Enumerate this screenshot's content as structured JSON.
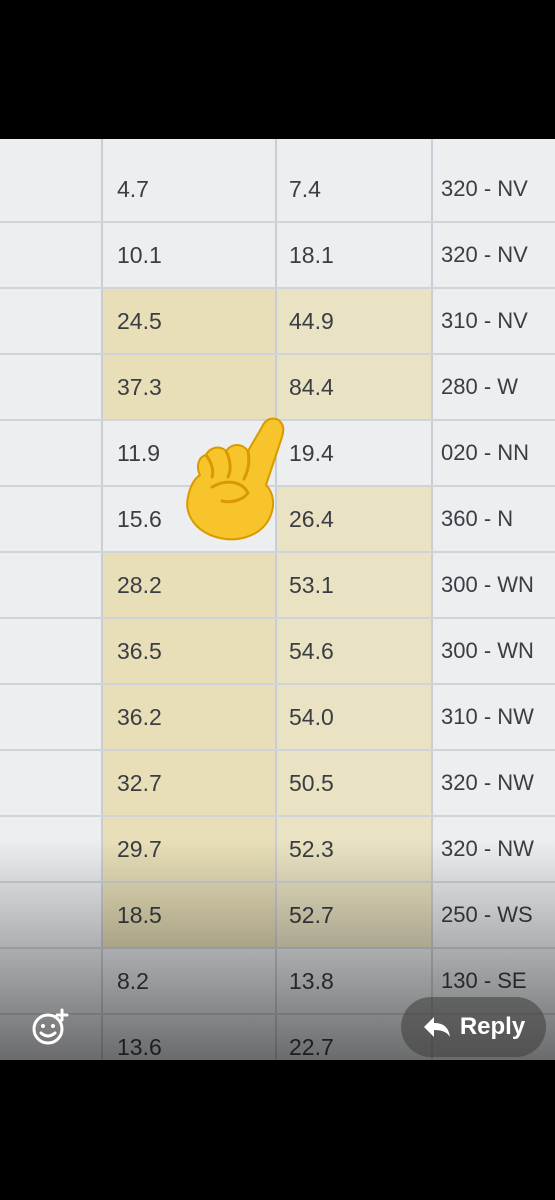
{
  "table": {
    "rows": [
      {
        "c1": "4.7",
        "c2": "7.4",
        "c3": "320 - NV",
        "hl": [
          0,
          0
        ]
      },
      {
        "c1": "10.1",
        "c2": "18.1",
        "c3": "320 - NV",
        "hl": [
          0,
          0
        ]
      },
      {
        "c1": "24.5",
        "c2": "44.9",
        "c3": "310 - NV",
        "hl": [
          1,
          1
        ]
      },
      {
        "c1": "37.3",
        "c2": "84.4",
        "c3": "280 - W",
        "hl": [
          1,
          1
        ]
      },
      {
        "c1": "11.9",
        "c2": "19.4",
        "c3": "020 - NN",
        "hl": [
          0,
          0
        ]
      },
      {
        "c1": "15.6",
        "c2": "26.4",
        "c3": "360 - N",
        "hl": [
          0,
          1
        ]
      },
      {
        "c1": "28.2",
        "c2": "53.1",
        "c3": "300 - WN",
        "hl": [
          1,
          1
        ]
      },
      {
        "c1": "36.5",
        "c2": "54.6",
        "c3": "300 - WN",
        "hl": [
          1,
          1
        ]
      },
      {
        "c1": "36.2",
        "c2": "54.0",
        "c3": "310 - NW",
        "hl": [
          1,
          1
        ]
      },
      {
        "c1": "32.7",
        "c2": "50.5",
        "c3": "320 - NW",
        "hl": [
          1,
          1
        ]
      },
      {
        "c1": "29.7",
        "c2": "52.3",
        "c3": "320 - NW",
        "hl": [
          1,
          1
        ]
      },
      {
        "c1": "18.5",
        "c2": "52.7",
        "c3": "250 - WS",
        "hl": [
          1,
          1
        ]
      },
      {
        "c1": "8.2",
        "c2": "13.8",
        "c3": "130 - SE",
        "hl": [
          0,
          0
        ]
      },
      {
        "c1": "13.6",
        "c2": "22.7",
        "c3": "",
        "hl": [
          0,
          0
        ]
      }
    ]
  },
  "overlay": {
    "emoji_icon": "pointing-up-hand-icon",
    "react_icon": "add-reaction-icon",
    "reply_label": "Reply",
    "reply_icon": "reply-arrow-icon"
  },
  "colors": {
    "highlight": "#e8dfb8",
    "background": "#000000"
  }
}
